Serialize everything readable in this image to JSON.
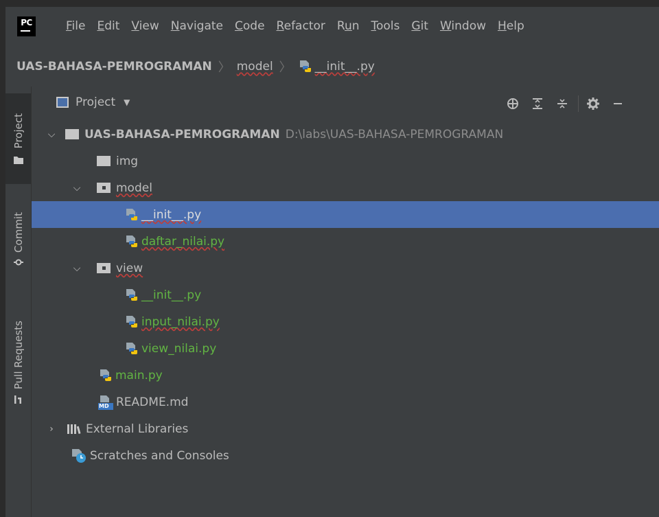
{
  "app": {
    "logo": "PC"
  },
  "menu": [
    {
      "pre": "",
      "ul": "F",
      "post": "ile"
    },
    {
      "pre": "",
      "ul": "E",
      "post": "dit"
    },
    {
      "pre": "",
      "ul": "V",
      "post": "iew"
    },
    {
      "pre": "",
      "ul": "N",
      "post": "avigate"
    },
    {
      "pre": "",
      "ul": "C",
      "post": "ode"
    },
    {
      "pre": "",
      "ul": "R",
      "post": "efactor"
    },
    {
      "pre": "R",
      "ul": "u",
      "post": "n"
    },
    {
      "pre": "",
      "ul": "T",
      "post": "ools"
    },
    {
      "pre": "",
      "ul": "G",
      "post": "it"
    },
    {
      "pre": "",
      "ul": "W",
      "post": "indow"
    },
    {
      "pre": "",
      "ul": "H",
      "post": "elp"
    }
  ],
  "breadcrumb": {
    "root": "UAS-BAHASA-PEMROGRAMAN",
    "folder": "model",
    "file": "__init__.py"
  },
  "sidebar": {
    "project": "Project",
    "commit": "Commit",
    "pull_requests": "Pull Requests"
  },
  "panel": {
    "title": "Project"
  },
  "tree": {
    "root_name": "UAS-BAHASA-PEMROGRAMAN",
    "root_path": "D:\\labs\\UAS-BAHASA-PEMROGRAMAN",
    "img": "img",
    "model": "model",
    "model_init": "__init__.py",
    "daftar": "daftar_nilai.py",
    "view": "view",
    "view_init": "__init__.py",
    "input": "input_nilai.py",
    "view_nilai": "view_nilai.py",
    "main": "main.py",
    "readme": "README.md",
    "md_badge": "MD",
    "ext_libs": "External Libraries",
    "scratches": "Scratches and Consoles"
  },
  "colors": {
    "selection": "#4b6eaf",
    "added_file": "#62b543",
    "background": "#3c3f41"
  }
}
